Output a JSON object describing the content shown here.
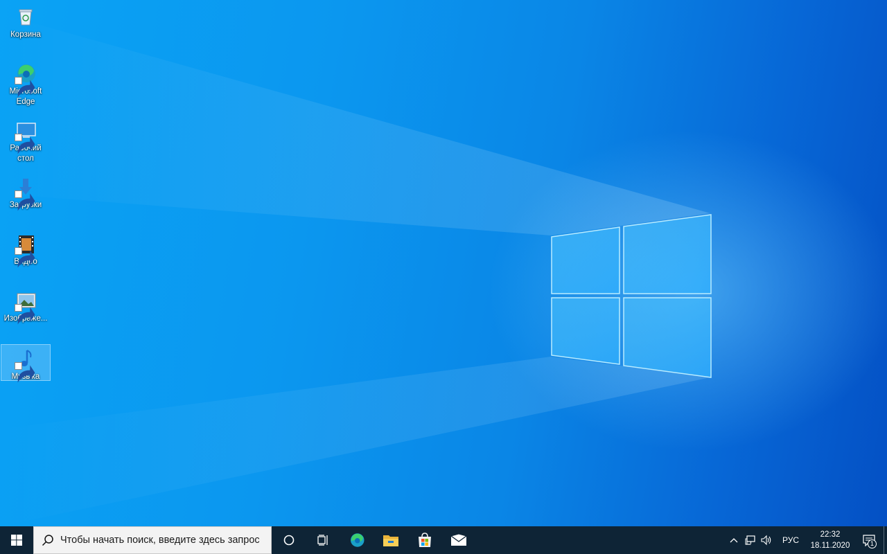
{
  "desktop": {
    "icons": [
      {
        "label": "Корзина",
        "icon": "recycle-bin-icon"
      },
      {
        "label": "Microsoft Edge",
        "icon": "edge-icon"
      },
      {
        "label": "Рабочий стол",
        "icon": "desktop-folder-icon"
      },
      {
        "label": "Загрузки",
        "icon": "downloads-icon"
      },
      {
        "label": "Видео",
        "icon": "videos-icon"
      },
      {
        "label": "Изображе...",
        "icon": "pictures-icon"
      },
      {
        "label": "Музыка",
        "icon": "music-icon",
        "selected": true
      }
    ]
  },
  "taskbar": {
    "search": {
      "placeholder": "Чтобы начать поиск, введите здесь запрос",
      "value": ""
    },
    "pinned": [
      "cortana-icon",
      "task-view-icon",
      "edge-icon",
      "file-explorer-icon",
      "store-icon",
      "mail-icon"
    ],
    "tray": {
      "language": "РУС",
      "time": "22:32",
      "date": "18.11.2020",
      "notification_count": "1"
    }
  },
  "colors": {
    "taskbar": "#0e2436",
    "wallpaper_primary": "#0a8ee8",
    "accent": "#0078d7"
  }
}
